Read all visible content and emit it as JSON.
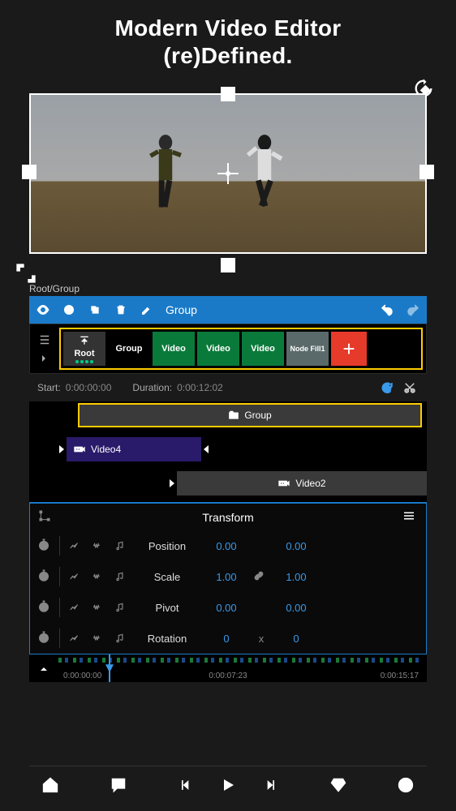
{
  "header": {
    "line1": "Modern Video Editor",
    "line2": "(re)Defined."
  },
  "breadcrumb": "Root/Group",
  "toolbar": {
    "group_label": "Group"
  },
  "layers": {
    "root_label": "Root",
    "thumbs": [
      {
        "label": "Group"
      },
      {
        "label": "Video"
      },
      {
        "label": "Video"
      },
      {
        "label": "Video"
      },
      {
        "label": "Node Fill1"
      }
    ],
    "add_label": "+"
  },
  "timeline": {
    "start_label": "Start:",
    "start_value": "0:00:00:00",
    "duration_label": "Duration:",
    "duration_value": "0:00:12:02"
  },
  "tracks": {
    "group_label": "Group",
    "video4_label": "Video4",
    "video2_label": "Video2"
  },
  "transform": {
    "title": "Transform",
    "rows": [
      {
        "label": "Position",
        "v1": "0.00",
        "v2": "0.00",
        "link": false
      },
      {
        "label": "Scale",
        "v1": "1.00",
        "v2": "1.00",
        "link": true
      },
      {
        "label": "Pivot",
        "v1": "0.00",
        "v2": "0.00",
        "link": false
      },
      {
        "label": "Rotation",
        "v1": "0",
        "v2": "0",
        "link": false,
        "xlabel": "x"
      }
    ]
  },
  "ruler": {
    "t1": "0:00:00:00",
    "t2": "0:00:07:23",
    "t3": "0:00:15:17"
  }
}
